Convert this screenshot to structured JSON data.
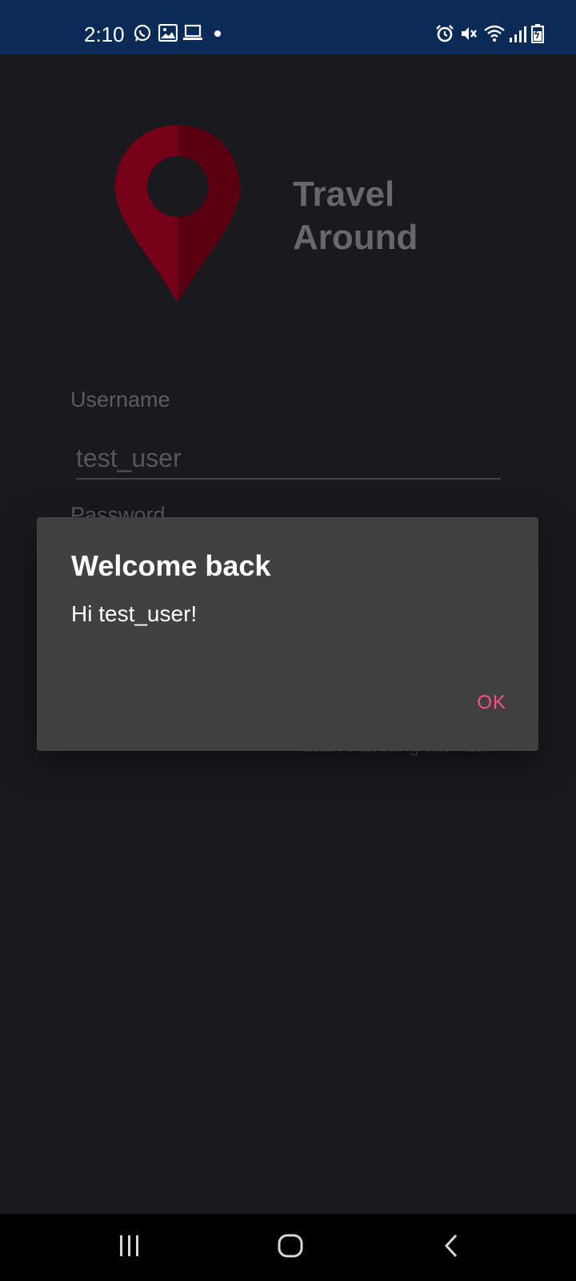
{
  "status_bar": {
    "time": "2:10",
    "left_icons": [
      "whatsapp-icon",
      "gallery-icon",
      "laptop-icon",
      "dot-icon"
    ],
    "right_icons": [
      "alarm-icon",
      "mute-icon",
      "wifi-icon",
      "signal-icon",
      "battery-icon"
    ],
    "background": "#0a2b55"
  },
  "app": {
    "title_line1": "Travel",
    "title_line2": "Around",
    "logo_icon": "map-pin-icon",
    "logo_color": "#6b0017",
    "username_label": "Username",
    "username_value": "test_user",
    "password_label": "Password",
    "signup_text": "Start traveling with us!"
  },
  "dialog": {
    "title": "Welcome back",
    "message": "Hi test_user!",
    "ok_label": "OK",
    "accent": "#ff4f86"
  },
  "nav_bar": {
    "icons": [
      "recent-apps-icon",
      "home-icon",
      "back-icon"
    ]
  }
}
